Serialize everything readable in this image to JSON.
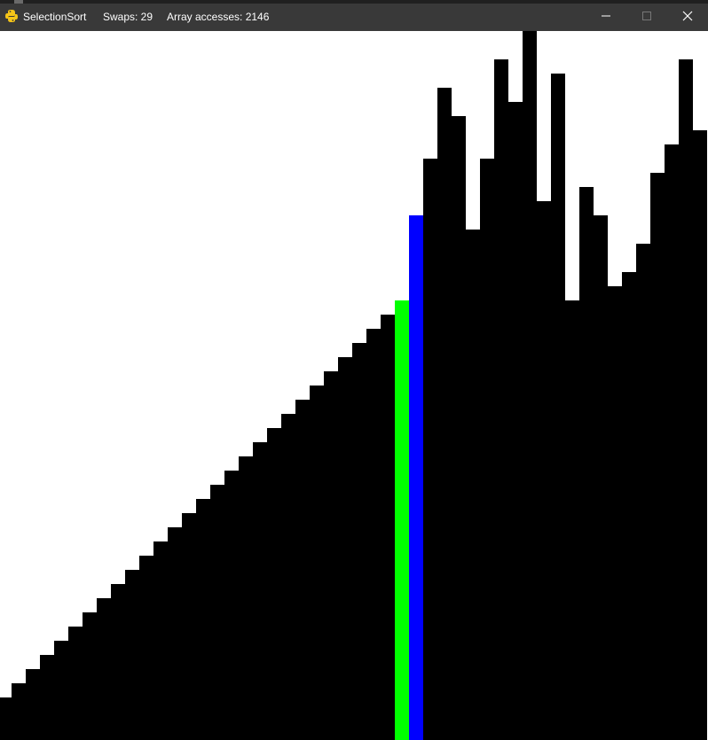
{
  "window": {
    "title": "SelectionSort",
    "swaps": "Swaps: 29",
    "array_accesses": "Array accesses: 2146"
  },
  "icons": {
    "app": "python-snake-icon",
    "minimize": "minimize-icon",
    "maximize": "maximize-icon",
    "close": "close-icon"
  },
  "colors": {
    "bar": "#000000",
    "compare": "#00ff00",
    "current": "#0000ff",
    "background": "#ffffff",
    "titlebar": "#393939"
  },
  "visualization": {
    "array": [
      2,
      3,
      4,
      5,
      6,
      7,
      8,
      9,
      10,
      11,
      12,
      13,
      14,
      15,
      16,
      17,
      18,
      19,
      20,
      21,
      22,
      23,
      24,
      25,
      26,
      27,
      28,
      29,
      30,
      31,
      37,
      41,
      46,
      44,
      36,
      41,
      48,
      45,
      50,
      38,
      47,
      31,
      39,
      37,
      32,
      33,
      35,
      40,
      42,
      48,
      43
    ],
    "scale_max": 50,
    "green_index": 29,
    "blue_index": 30
  }
}
